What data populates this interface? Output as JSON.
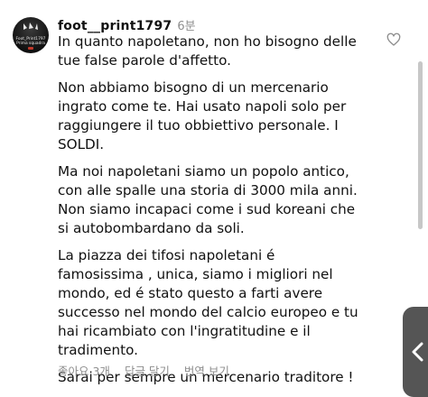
{
  "comment": {
    "username": "foot__print1797",
    "timestamp": "6분",
    "avatar_lines": [
      "Foot_Print1797",
      "Prima squadra"
    ],
    "paragraphs": [
      "In quanto napoletano, non ho bisogno delle tue false parole d'affetto.",
      "Non abbiamo bisogno di un mercenario ingrato come te. Hai usato napoli solo per raggiungere il tuo obbiettivo personale.  I SOLDI.",
      "Ma noi napoletani siamo un popolo antico, con alle spalle una storia di 3000 mila anni. Non siamo incapaci come i sud koreani che si autobombardano da soli.",
      "La piazza dei tifosi napoletani é famosissima , unica, siamo i migliori nel mondo, ed é stato questo a farti avere successo nel mondo del calcio europeo e tu hai ricambiato con l'ingratitudine e il tradimento.",
      "Sarai per sempre un mercenario traditore !"
    ],
    "actions": {
      "likes_label": "좋아요 3개",
      "reply_label": "답글 달기",
      "translate_label": "번역 보기"
    }
  },
  "icons": {
    "like": "heart-outline-icon",
    "scroll": "chevron-left-icon"
  },
  "colors": {
    "text": "#111111",
    "muted": "#8e8e8e",
    "scroll_handle": "#555555"
  }
}
